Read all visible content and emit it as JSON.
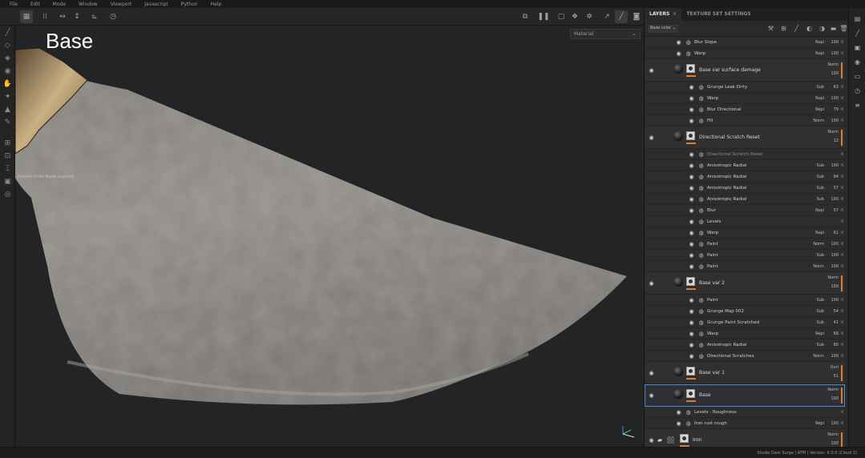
{
  "menu": [
    "File",
    "Edit",
    "Mode",
    "Window",
    "Viewport",
    "Javascript",
    "Python",
    "Help"
  ],
  "viewport": {
    "title": "Base",
    "mode_select": "Material",
    "info_text": "Painted Knife Blade Layered"
  },
  "panel": {
    "tabs": [
      {
        "label": "LAYERS",
        "active": true,
        "close": "×"
      },
      {
        "label": "TEXTURE SET SETTINGS",
        "active": false
      }
    ],
    "blend_select": "Base color"
  },
  "layers": {
    "top_effects": [
      {
        "name": "Blur Slope",
        "blend": "Repl",
        "opacity": "100"
      },
      {
        "name": "Warp",
        "blend": "Repl",
        "opacity": "100"
      }
    ],
    "surface_damage": {
      "name": "Base var surface damage",
      "blend": "Norm",
      "opacity": "100",
      "effects": [
        {
          "name": "Grunge Leak Dirty",
          "blend": "Sub",
          "opacity": "63"
        },
        {
          "name": "Warp",
          "blend": "Repl",
          "opacity": "100"
        },
        {
          "name": "Blur Directional",
          "blend": "Repl",
          "opacity": "79"
        },
        {
          "name": "Fill",
          "blend": "Norm",
          "opacity": "100"
        }
      ]
    },
    "directional_scratch": {
      "name": "Directional Scratch Reset",
      "blend": "Norm",
      "opacity": "12",
      "effects": [
        {
          "name": "Directional Scratch Reset",
          "blend": "",
          "opacity": "",
          "dim": true
        },
        {
          "name": "Anisotropic Radial",
          "blend": "Sub",
          "opacity": "100"
        },
        {
          "name": "Anisotropic Radial",
          "blend": "Sub",
          "opacity": "84"
        },
        {
          "name": "Anisotropic Radial",
          "blend": "Sub",
          "opacity": "57"
        },
        {
          "name": "Anisotropic Radial",
          "blend": "Sub",
          "opacity": "100"
        },
        {
          "name": "Blur",
          "blend": "Repl",
          "opacity": "57"
        },
        {
          "name": "Levels",
          "blend": "",
          "opacity": ""
        },
        {
          "name": "Warp",
          "blend": "Repl",
          "opacity": "61"
        },
        {
          "name": "Paint",
          "blend": "Norm",
          "opacity": "100"
        },
        {
          "name": "Paint",
          "blend": "Sub",
          "opacity": "100"
        },
        {
          "name": "Paint",
          "blend": "Norm",
          "opacity": "100"
        }
      ]
    },
    "base_var_2": {
      "name": "Base var 2",
      "blend": "Norm",
      "opacity": "100",
      "effects": [
        {
          "name": "Paint",
          "blend": "Sub",
          "opacity": "100"
        },
        {
          "name": "Grunge Map 002",
          "blend": "Sub",
          "opacity": "54"
        },
        {
          "name": "Grunge Paint Scratched",
          "blend": "Sub",
          "opacity": "41"
        },
        {
          "name": "Warp",
          "blend": "Repl",
          "opacity": "68"
        },
        {
          "name": "Anisotropic Radial",
          "blend": "Sub",
          "opacity": "80"
        },
        {
          "name": "Directional Scratches",
          "blend": "Norm",
          "opacity": "100"
        }
      ]
    },
    "base_var_1": {
      "name": "Base var 1",
      "blend": "Ovrl",
      "opacity": "51"
    },
    "base": {
      "name": "Base",
      "blend": "Norm",
      "opacity": "100",
      "effects": [
        {
          "name": "Levels - Roughness",
          "blend": "",
          "opacity": ""
        },
        {
          "name": "Iron rust rough",
          "blend": "Repl",
          "opacity": "100"
        }
      ]
    },
    "folder": {
      "name": "Iron",
      "blend": "Norm",
      "opacity": "100"
    }
  },
  "status": {
    "text": "Studio Dark Surge | ATM | Version: 6.0.0 (Cloud 2)"
  },
  "colors": {
    "accent": "#e07b2a",
    "selection": "#4a8ccf"
  }
}
